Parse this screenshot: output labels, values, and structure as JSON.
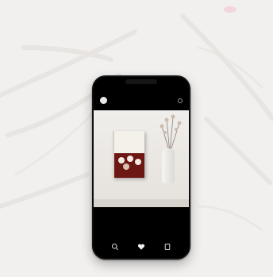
{
  "post": {
    "username": "",
    "book_title": "",
    "caption_lines": [
      "",
      ""
    ]
  },
  "bottom_nav": {
    "icons": [
      "search-icon",
      "heart-icon",
      "bookmark-icon"
    ]
  },
  "colors": {
    "background": "#f2f0ee",
    "phone_body": "#0f0f10",
    "book_accent": "#7a1e1c",
    "book_art": "#6d1715"
  }
}
